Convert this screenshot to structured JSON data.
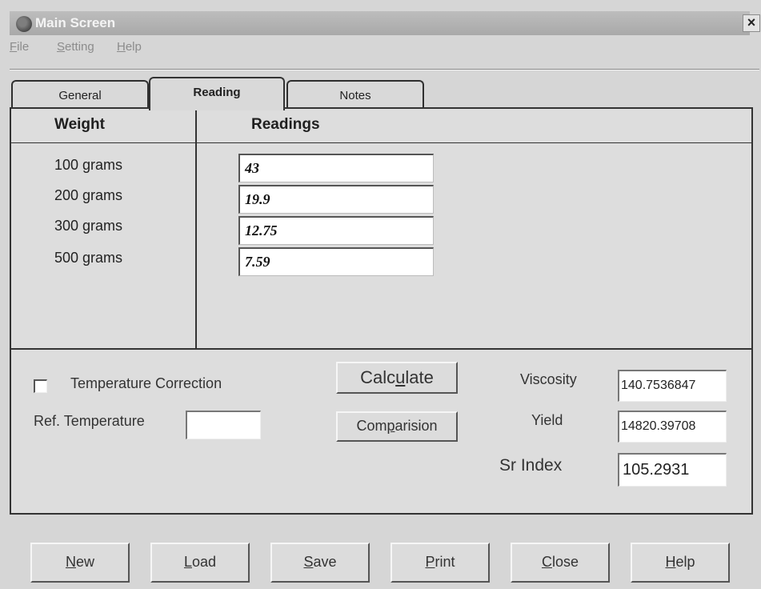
{
  "window": {
    "title": "Main Screen",
    "close_glyph": "×",
    "icon": "app-globe-icon"
  },
  "menu": [
    {
      "pre": "",
      "u": "F",
      "post": "ile"
    },
    {
      "pre": "",
      "u": "S",
      "post": "etting"
    },
    {
      "pre": "",
      "u": "H",
      "post": "elp"
    }
  ],
  "tabs": [
    "General",
    "Reading",
    "Notes"
  ],
  "reading": {
    "weight_header": "Weight",
    "readings_header": "Readings",
    "rows": [
      {
        "weight": "100 grams",
        "value": "43"
      },
      {
        "weight": "200 grams",
        "value": "19.9"
      },
      {
        "weight": "300 grams",
        "value": "12.75"
      },
      {
        "weight": "500 grams",
        "value": "7.59"
      }
    ]
  },
  "options": {
    "temp_correction_label": "Temperature Correction",
    "temp_correction_checked": false,
    "ref_temperature_label": "Ref. Temperature",
    "ref_temperature_value": ""
  },
  "actions": {
    "calculate": {
      "pre": "Calc",
      "u": "u",
      "post": "late"
    },
    "comparision": {
      "pre": "Com",
      "u": "p",
      "post": "arision"
    }
  },
  "results": {
    "viscosity_label": "Viscosity",
    "viscosity_value": "140.7536847",
    "yield_label": "Yield",
    "yield_value": "14820.39708",
    "sr_index_label": "Sr Index",
    "sr_index_value": "105.2931"
  },
  "footer_buttons": [
    {
      "u": "N",
      "post": "ew"
    },
    {
      "u": "L",
      "post": "oad"
    },
    {
      "u": "S",
      "post": "ave"
    },
    {
      "u": "P",
      "post": "rint"
    },
    {
      "u": "C",
      "post": "lose"
    },
    {
      "u": "H",
      "post": "elp"
    }
  ]
}
